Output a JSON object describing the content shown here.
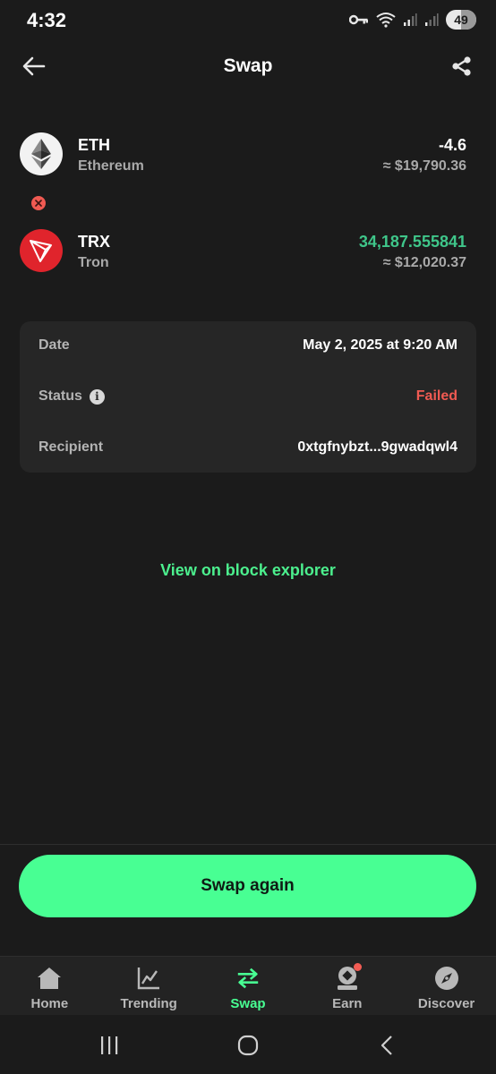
{
  "status_bar": {
    "time": "4:32",
    "battery": "49"
  },
  "header": {
    "title": "Swap"
  },
  "swap": {
    "from": {
      "symbol": "ETH",
      "name": "Ethereum",
      "amount": "-4.6",
      "fiat": "≈ $19,790.36",
      "icon": "ethereum-logo-icon"
    },
    "to": {
      "symbol": "TRX",
      "name": "Tron",
      "amount": "34,187.555841",
      "fiat": "≈ $12,020.37",
      "icon": "tron-logo-icon"
    }
  },
  "details": {
    "date_label": "Date",
    "date_value": "May 2, 2025 at 9:20 AM",
    "status_label": "Status",
    "status_value": "Failed",
    "recipient_label": "Recipient",
    "recipient_value": "0xtgfnybzt...9gwadqwl4"
  },
  "explorer_link": "View on block explorer",
  "swap_again": "Swap again",
  "nav": {
    "items": [
      {
        "label": "Home",
        "icon": "home-icon"
      },
      {
        "label": "Trending",
        "icon": "chart-icon"
      },
      {
        "label": "Swap",
        "icon": "swap-arrows-icon"
      },
      {
        "label": "Earn",
        "icon": "earn-icon"
      },
      {
        "label": "Discover",
        "icon": "compass-icon"
      }
    ],
    "active": "Swap"
  },
  "colors": {
    "background": "#1b1b1b",
    "card": "#262626",
    "accent": "#48ff93",
    "link": "#4cf08e",
    "positive": "#3fc68a",
    "failed": "#f05a52",
    "tron": "#e0242c"
  }
}
